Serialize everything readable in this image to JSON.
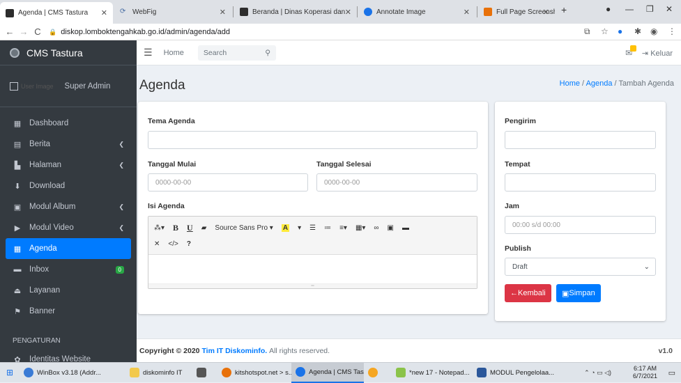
{
  "browser": {
    "tabs": [
      {
        "title": "Agenda | CMS Tastura",
        "color": "#2d2d2d"
      },
      {
        "title": "WebFig",
        "color": "#4a6fa5"
      },
      {
        "title": "Beranda | Dinas Koperasi dan",
        "color": "#2d2d2d"
      },
      {
        "title": "Annotate Image",
        "color": "#1a73e8"
      },
      {
        "title": "Full Page Screenshot - Chrom",
        "color": "#e8710a"
      }
    ],
    "url": "diskop.lomboktengahkab.go.id/admin/agenda/add"
  },
  "sidebar": {
    "brand": "CMS Tastura",
    "user_img_alt": "User Image",
    "user_name": "Super Admin",
    "items": [
      {
        "label": "Dashboard",
        "icon": "grid-icon",
        "arrow": false
      },
      {
        "label": "Berita",
        "icon": "newspaper-icon",
        "arrow": true
      },
      {
        "label": "Halaman",
        "icon": "file-icon",
        "arrow": true
      },
      {
        "label": "Download",
        "icon": "download-icon",
        "arrow": false
      },
      {
        "label": "Modul Album",
        "icon": "images-icon",
        "arrow": true
      },
      {
        "label": "Modul Video",
        "icon": "play-icon",
        "arrow": true
      },
      {
        "label": "Agenda",
        "icon": "calendar-icon",
        "arrow": false,
        "active": true
      },
      {
        "label": "Inbox",
        "icon": "inbox-icon",
        "badge": "0"
      },
      {
        "label": "Layanan",
        "icon": "eject-icon",
        "arrow": false
      },
      {
        "label": "Banner",
        "icon": "flag-icon",
        "arrow": false
      }
    ],
    "section": "PENGATURAN",
    "section_item": "Identitas Website"
  },
  "topnav": {
    "home": "Home",
    "search_placeholder": "Search",
    "logout": "Keluar"
  },
  "page": {
    "title": "Agenda",
    "breadcrumb": [
      "Home",
      "Agenda",
      "Tambah Agenda"
    ]
  },
  "form": {
    "tema_label": "Tema Agenda",
    "mulai_label": "Tanggal Mulai",
    "mulai_placeholder": "0000-00-00",
    "selesai_label": "Tanggal Selesai",
    "selesai_placeholder": "0000-00-00",
    "isi_label": "Isi Agenda",
    "font_name": "Source Sans Pro",
    "pengirim_label": "Pengirim",
    "tempat_label": "Tempat",
    "jam_label": "Jam",
    "jam_placeholder": "00:00 s/d 00:00",
    "publish_label": "Publish",
    "publish_value": "Draft",
    "back_label": "Kembali",
    "save_label": "Simpan"
  },
  "footer": {
    "copyright": "Copyright © 2020",
    "team": "Tim IT Diskominfo.",
    "rights": "All rights reserved.",
    "version": "v1.0"
  },
  "taskbar": {
    "items": [
      {
        "label": "WinBox v3.18 (Addr...",
        "color": "#3a7bd5"
      },
      {
        "label": "diskominfo IT",
        "color": "#f2c94c"
      },
      {
        "label": "",
        "color": "#555"
      },
      {
        "label": "kitshotspot.net > s...",
        "color": "#e8710a"
      },
      {
        "label": "Agenda | CMS Tast...",
        "color": "#1a73e8",
        "active": true
      },
      {
        "label": "",
        "color": "#f5a623"
      },
      {
        "label": "*new 17 - Notepad...",
        "color": "#8bc34a"
      },
      {
        "label": "MODUL Pengelolaa...",
        "color": "#2b579a"
      }
    ],
    "time": "6:17 AM",
    "date": "6/7/2021"
  }
}
